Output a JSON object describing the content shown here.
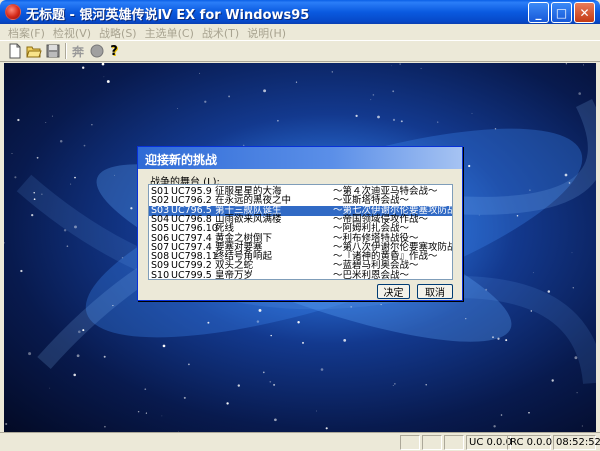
{
  "window": {
    "title": "无标题 - 银河英雄传说Ⅳ EX for Windows95",
    "minimize": "_",
    "maximize": "□",
    "close": "✕"
  },
  "menu": [
    "档案(F)",
    "检视(V)",
    "战略(S)",
    "主选单(C)",
    "战术(T)",
    "说明(H)"
  ],
  "toolbar": {
    "items": [
      "new-file-icon",
      "open-folder-icon",
      "save-disk-icon",
      "stamp-icon",
      "record-icon",
      "help-icon"
    ],
    "stamp_glyph": "奔",
    "help_glyph": "?"
  },
  "dialog": {
    "title": "迎接新的挑战",
    "list_label": "战争的舞台 (L):",
    "scenarios": [
      {
        "id": "S01",
        "date": "UC795.9",
        "title": "征服星星的大海",
        "operation": "～第４次迪亚马特会战～"
      },
      {
        "id": "S02",
        "date": "UC796.2",
        "title": "在永远的黑夜之中",
        "operation": "～亚斯塔特会战～"
      },
      {
        "id": "S03",
        "date": "UC796.5",
        "title": "第十三舰队诞生",
        "operation": "～第七次伊谢尔伦要塞攻防战～"
      },
      {
        "id": "S04",
        "date": "UC796.8",
        "title": "山雨欲来风满楼",
        "operation": "～帝国领域侵攻作战～"
      },
      {
        "id": "S05",
        "date": "UC796.10",
        "title": "死线",
        "operation": "～阿姆利扎会战～"
      },
      {
        "id": "S06",
        "date": "UC797.4",
        "title": "黄金之树倒下",
        "operation": "～利布修塔特战役～"
      },
      {
        "id": "S07",
        "date": "UC797.4",
        "title": "要塞对要塞",
        "operation": "～第八次伊谢尔伦要塞攻防战～"
      },
      {
        "id": "S08",
        "date": "UC798.11",
        "title": "终结号角响起",
        "operation": "～『诸神的黄昏』作战～"
      },
      {
        "id": "S09",
        "date": "UC799.2",
        "title": "双头之蛇",
        "operation": "～蓝碧马利奥会战～"
      },
      {
        "id": "S10",
        "date": "UC799.5",
        "title": "皇帝万岁",
        "operation": "～巴米利恩会战～"
      }
    ],
    "selected_index": 2,
    "ok_label": "决定",
    "cancel_label": "取消"
  },
  "status": {
    "uc": "UC 0.0.0",
    "rc": "RC 0.0.0",
    "time": "08:52:52"
  },
  "colors": {
    "titlebar": "#0a5ae0",
    "selection": "#316ac5",
    "dialog_title": "#2f6bd6"
  }
}
